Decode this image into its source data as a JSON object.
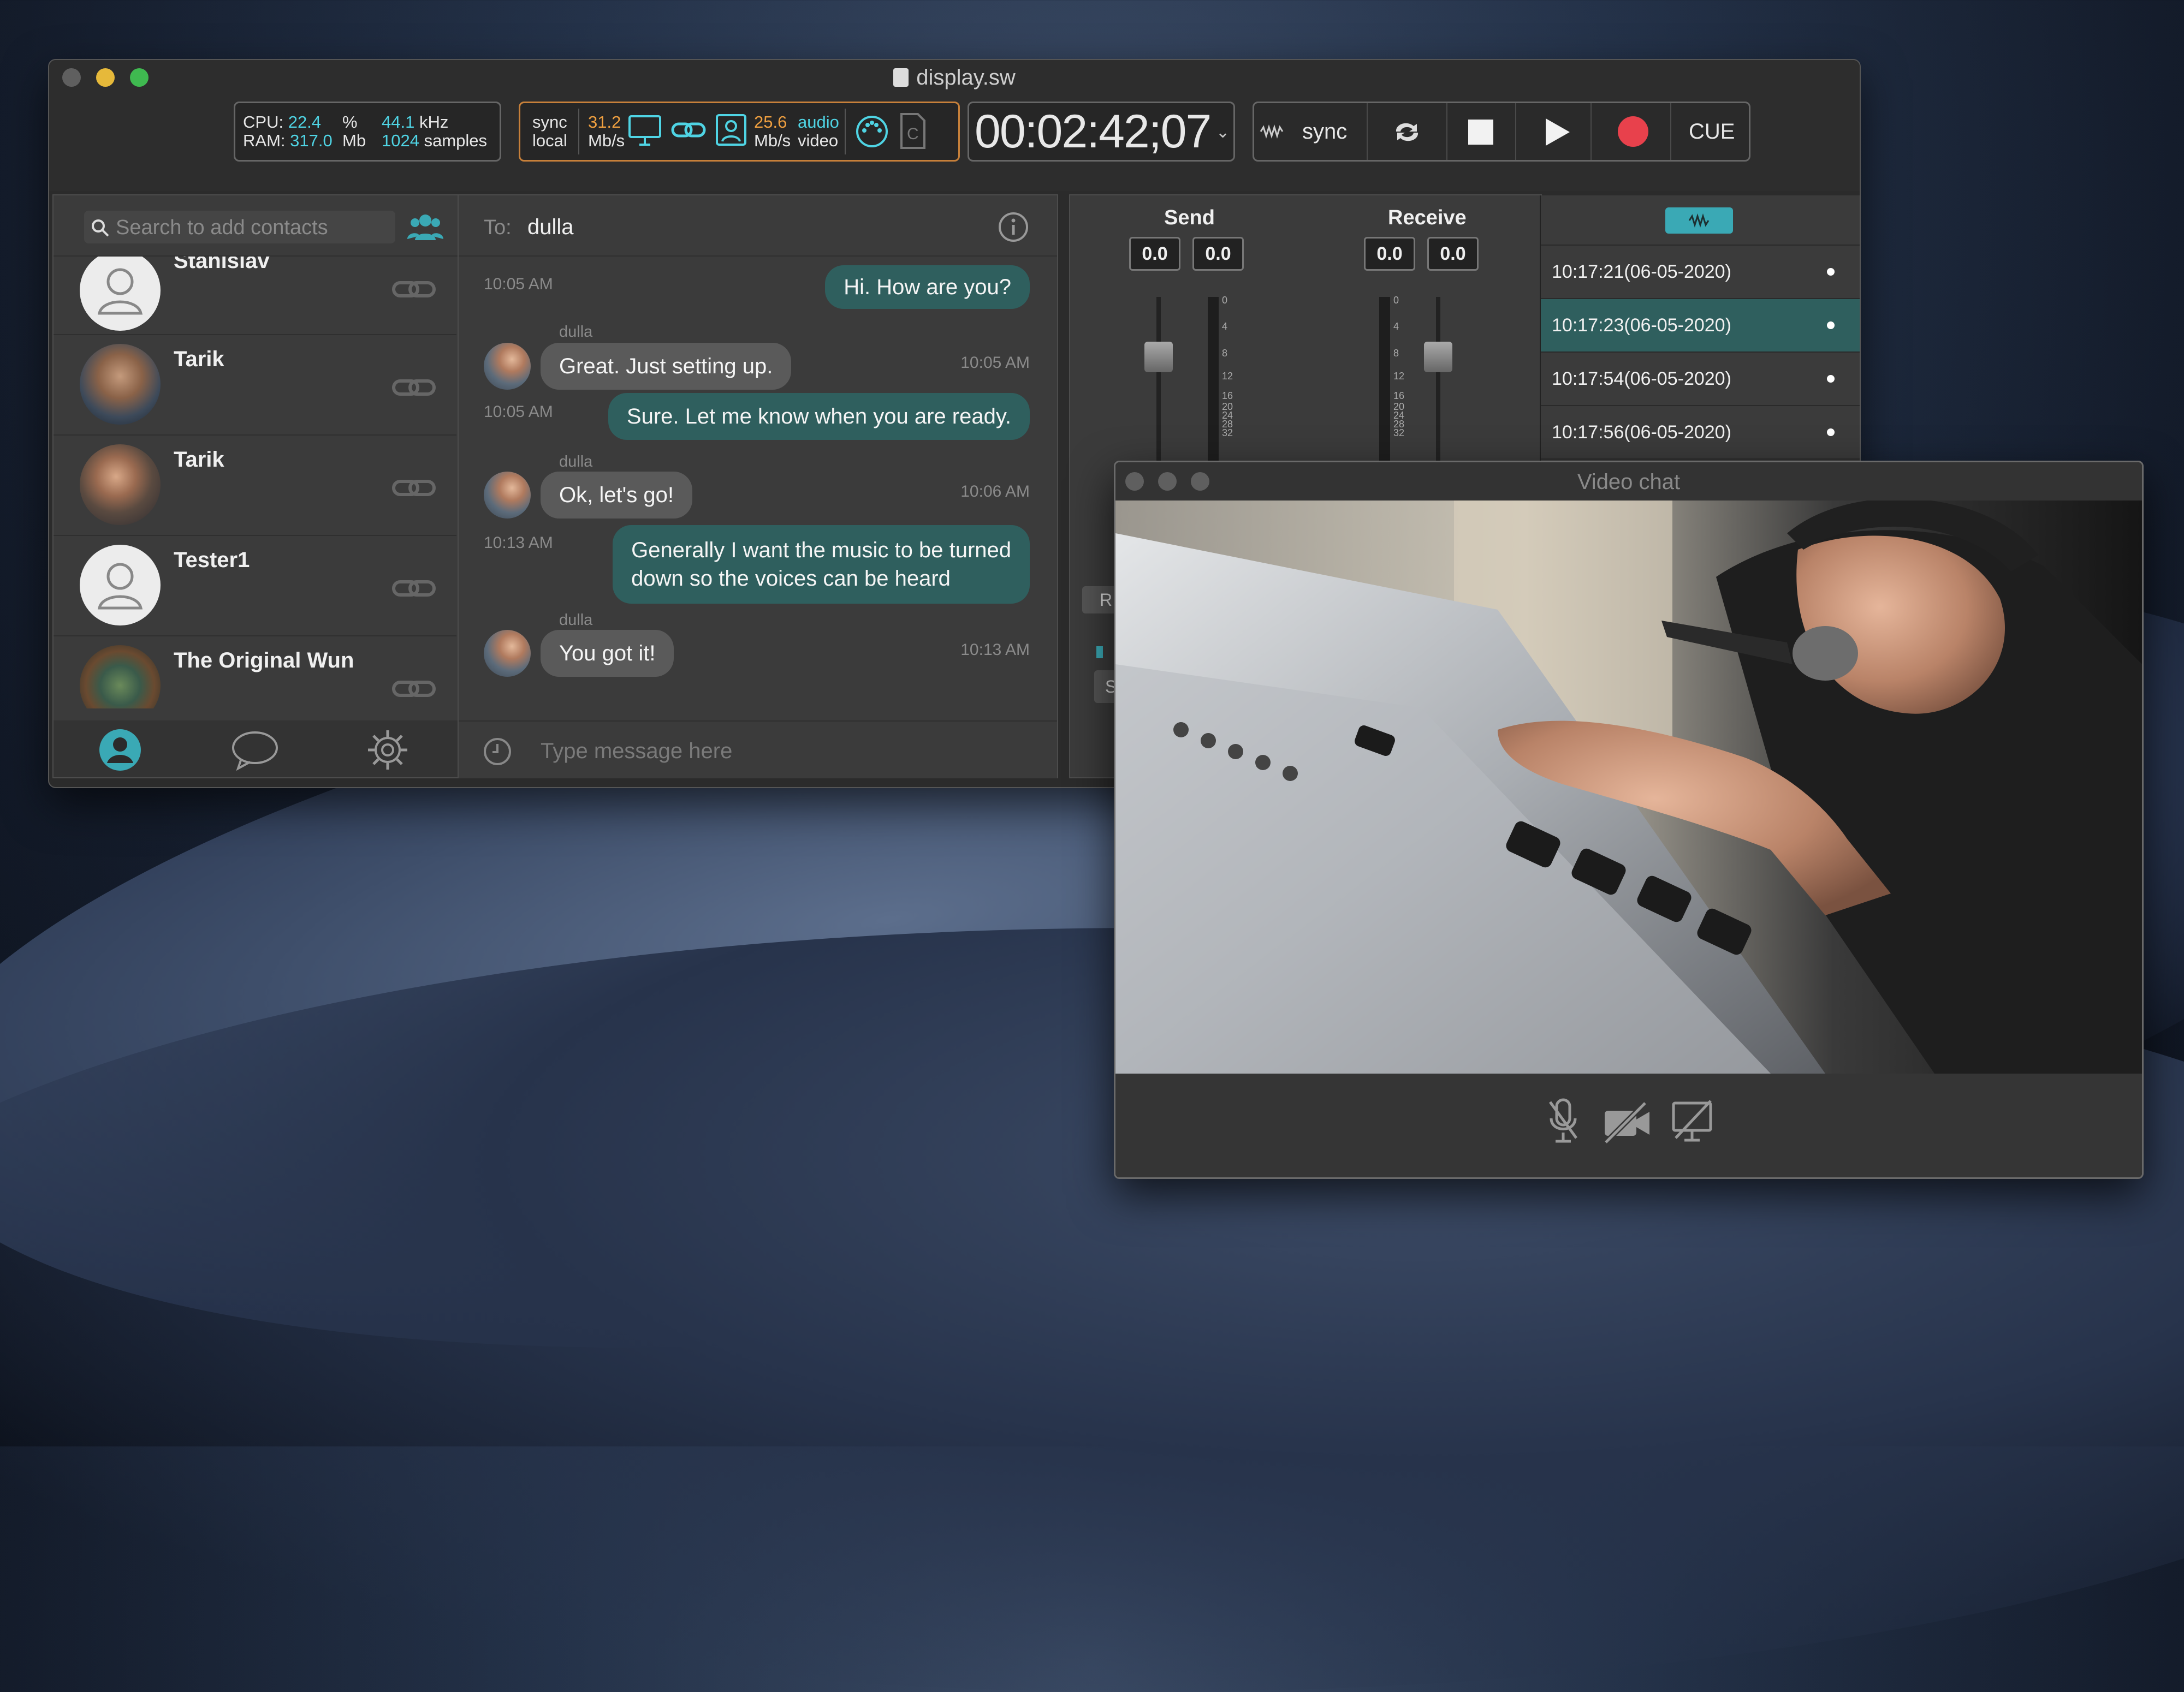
{
  "window": {
    "title": "display.sw"
  },
  "toolbar": {
    "cpu_label": "CPU:",
    "cpu_value": "22.4",
    "cpu_unit": "%",
    "ram_label": "RAM:",
    "ram_value": "317.0",
    "ram_unit": "Mb",
    "rate_value": "44.1",
    "rate_unit": "kHz",
    "buffer_value": "1024",
    "buffer_unit": "samples",
    "sync_label": "sync",
    "local_label": "local",
    "send_rate": "31.2",
    "send_rate_unit": "Mb/s",
    "recv_rate": "25.6",
    "recv_rate_unit": "Mb/s",
    "audio_label": "audio",
    "video_label": "video",
    "timecode": "00:02:42;07",
    "transport_sync_label": "sync",
    "cue_label": "CUE"
  },
  "contacts": {
    "search_placeholder": "Search to add contacts",
    "items": [
      {
        "name": "Stanislav"
      },
      {
        "name": "Tarik"
      },
      {
        "name": "Tarik"
      },
      {
        "name": "Tester1"
      },
      {
        "name": "The Original Wun"
      }
    ]
  },
  "chat": {
    "to_label": "To:",
    "to_value": "dulla",
    "input_placeholder": "Type message here",
    "messages": [
      {
        "text": "Hi. How are you?",
        "time": "10:05 AM"
      },
      {
        "sender": "dulla",
        "text": "Great. Just setting up.",
        "time": "10:05 AM"
      },
      {
        "text": "Sure. Let me know when you are ready.",
        "time": "10:05 AM"
      },
      {
        "sender": "dulla",
        "text": "Ok, let's go!",
        "time": "10:06 AM"
      },
      {
        "text_line1": "Generally I want the music to be turned",
        "text_line2": "down so the voices can be heard",
        "time": "10:13 AM"
      },
      {
        "sender": "dulla",
        "text": "You got it!",
        "time": "10:13 AM"
      }
    ]
  },
  "meters": {
    "send_label": "Send",
    "receive_label": "Receive",
    "send_values": [
      "0.0",
      "0.0"
    ],
    "receive_values": [
      "0.0",
      "0.0"
    ],
    "scale": [
      "0",
      "4",
      "8",
      "12",
      "16",
      "20",
      "24",
      "28",
      "32"
    ],
    "hidden_button_letter": "R",
    "hidden_button_letter2": "S"
  },
  "cues": {
    "items": [
      {
        "time": "10:17:21(06-05-2020)",
        "selected": false
      },
      {
        "time": "10:17:23(06-05-2020)",
        "selected": true
      },
      {
        "time": "10:17:54(06-05-2020)",
        "selected": false
      },
      {
        "time": "10:17:56(06-05-2020)",
        "selected": false
      }
    ]
  },
  "video_chat": {
    "title": "Video chat"
  },
  "colors": {
    "accent": "#4fd4e4",
    "teal": "#2f5f5e",
    "orange": "#f0a040",
    "record": "#e8414c"
  }
}
